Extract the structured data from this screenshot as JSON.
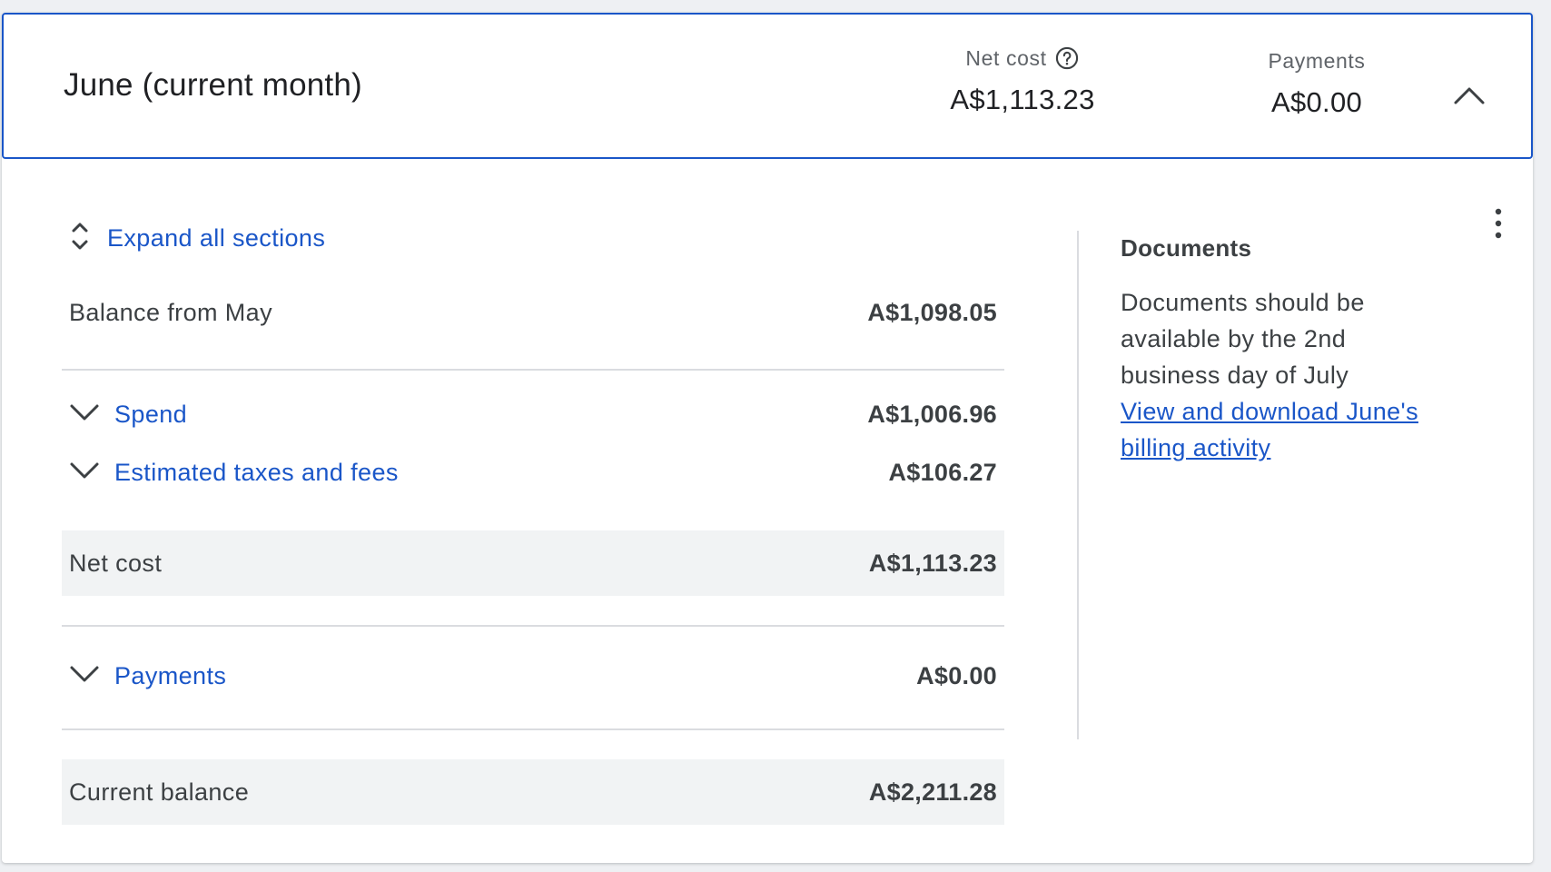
{
  "header": {
    "title": "June (current month)",
    "net_cost_label": "Net cost",
    "net_cost_value": "A$1,113.23",
    "payments_label": "Payments",
    "payments_value": "A$0.00"
  },
  "breakdown": {
    "expand_all_label": "Expand all sections",
    "balance_from_label": "Balance from May",
    "balance_from_value": "A$1,098.05",
    "spend_label": "Spend",
    "spend_value": "A$1,006.96",
    "taxes_label": "Estimated taxes and fees",
    "taxes_value": "A$106.27",
    "net_cost_label": "Net cost",
    "net_cost_value": "A$1,113.23",
    "payments_label": "Payments",
    "payments_value": "A$0.00",
    "current_balance_label": "Current balance",
    "current_balance_value": "A$2,211.28"
  },
  "documents": {
    "title": "Documents",
    "text": "Documents should be available by the 2nd business day of July",
    "link_line1": "View and download June's",
    "link_line2": "billing activity"
  },
  "colors": {
    "accent": "#1a56c8",
    "shaded_row": "#f1f3f4",
    "divider": "#dadce0"
  },
  "icons": [
    "help-icon",
    "chevron-up-icon",
    "unfold-more-icon",
    "chevron-down-icon",
    "more-vert-icon"
  ]
}
